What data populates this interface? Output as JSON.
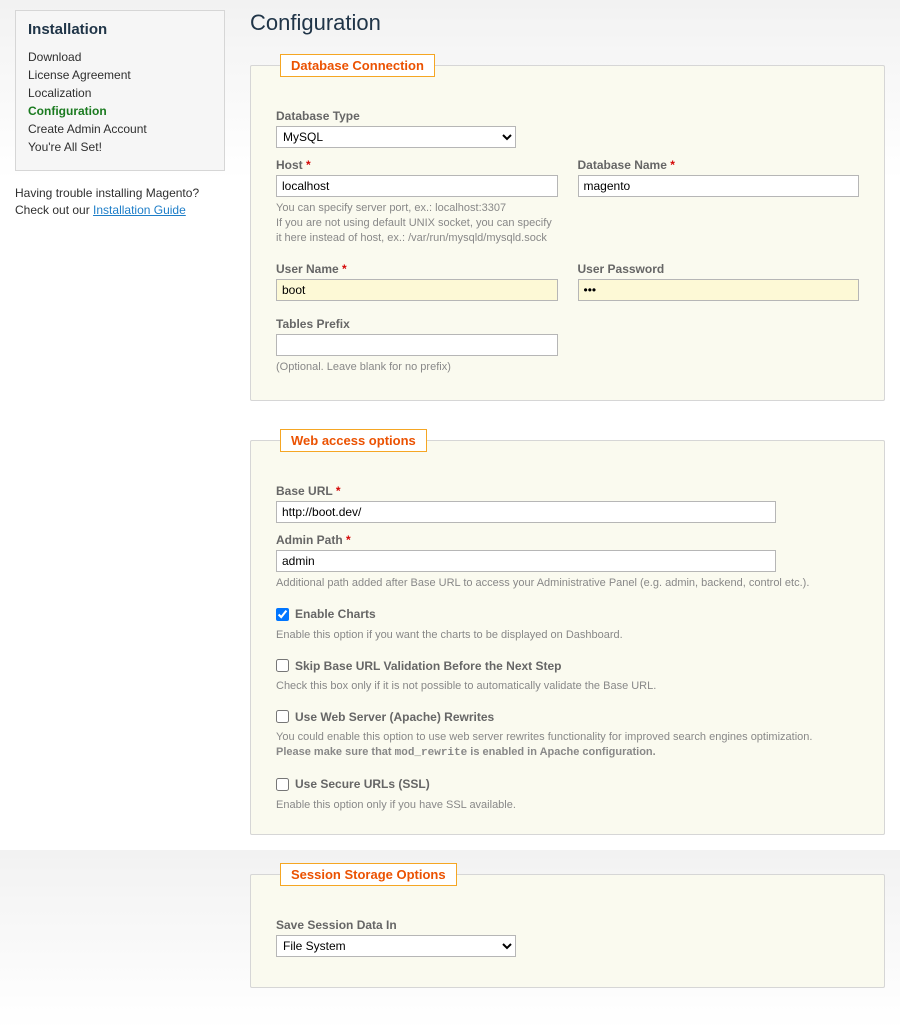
{
  "sidebar": {
    "title": "Installation",
    "items": [
      {
        "label": "Download",
        "active": false
      },
      {
        "label": "License Agreement",
        "active": false
      },
      {
        "label": "Localization",
        "active": false
      },
      {
        "label": "Configuration",
        "active": true
      },
      {
        "label": "Create Admin Account",
        "active": false
      },
      {
        "label": "You're All Set!",
        "active": false
      }
    ],
    "help_line1": "Having trouble installing Magento?",
    "help_line2_prefix": "Check out our ",
    "help_link": "Installation Guide"
  },
  "page_title": "Configuration",
  "db": {
    "legend": "Database Connection",
    "type_label": "Database Type",
    "type_value": "MySQL",
    "host_label": "Host",
    "host_value": "localhost",
    "host_hint": "You can specify server port, ex.: localhost:3307\nIf you are not using default UNIX socket, you can specify\nit here instead of host, ex.: /var/run/mysqld/mysqld.sock",
    "name_label": "Database Name",
    "name_value": "magento",
    "user_label": "User Name",
    "user_value": "boot",
    "pass_label": "User Password",
    "pass_value": "•••",
    "prefix_label": "Tables Prefix",
    "prefix_value": "",
    "prefix_hint": "(Optional. Leave blank for no prefix)"
  },
  "web": {
    "legend": "Web access options",
    "baseurl_label": "Base URL",
    "baseurl_value": "http://boot.dev/",
    "admin_label": "Admin Path",
    "admin_value": "admin",
    "admin_hint": "Additional path added after Base URL to access your Administrative Panel (e.g. admin, backend, control etc.).",
    "charts_label": "Enable Charts",
    "charts_hint": "Enable this option if you want the charts to be displayed on Dashboard.",
    "skip_label": "Skip Base URL Validation Before the Next Step",
    "skip_hint": "Check this box only if it is not possible to automatically validate the Base URL.",
    "rewrites_label": "Use Web Server (Apache) Rewrites",
    "rewrites_hint_1": "You could enable this option to use web server rewrites functionality for improved search engines optimization.",
    "rewrites_hint_2a": "Please make sure that ",
    "rewrites_hint_2b": "mod_rewrite",
    "rewrites_hint_2c": " is enabled in Apache configuration.",
    "ssl_label": "Use Secure URLs (SSL)",
    "ssl_hint": "Enable this option only if you have SSL available."
  },
  "session": {
    "legend": "Session Storage Options",
    "save_label": "Save Session Data In",
    "save_value": "File System"
  }
}
